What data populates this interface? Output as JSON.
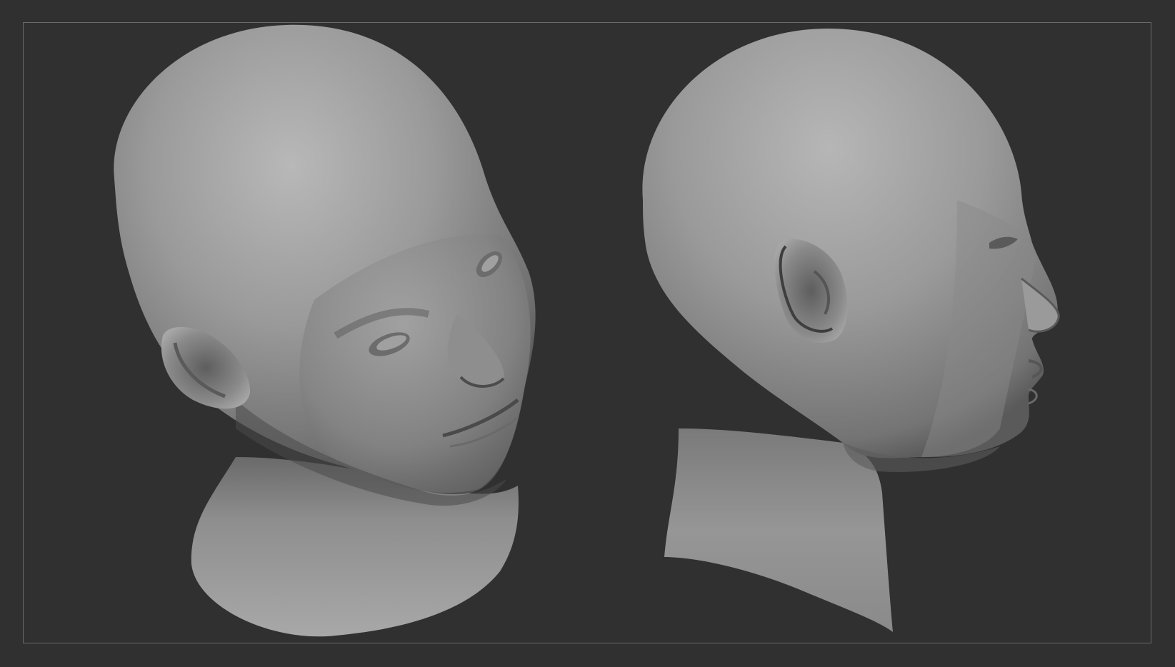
{
  "viewport": {
    "background_color": "#303030",
    "frame_color": "#6a6a6a",
    "surface_color": "#8c8c8c"
  },
  "views": [
    {
      "name": "three-quarter-view",
      "label": ""
    },
    {
      "name": "profile-view",
      "label": ""
    }
  ]
}
